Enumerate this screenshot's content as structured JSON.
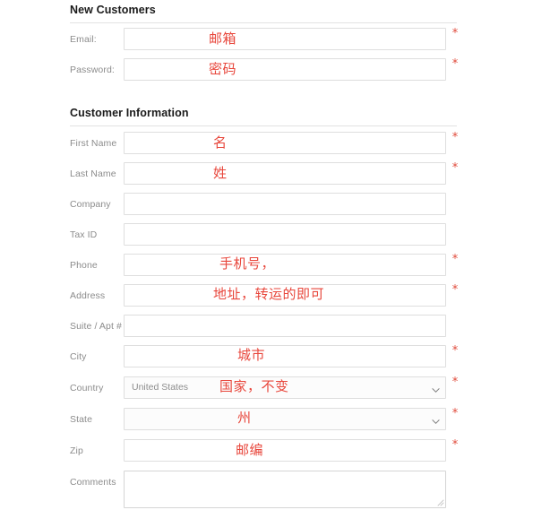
{
  "sections": [
    {
      "title": "New Customers"
    },
    {
      "title": "Customer Information"
    }
  ],
  "fields": {
    "email": {
      "label": "Email:",
      "value": "",
      "placeholder": "",
      "required": true,
      "annotation": "邮箱"
    },
    "password": {
      "label": "Password:",
      "value": "",
      "placeholder": "",
      "required": true,
      "annotation": "密码"
    },
    "first_name": {
      "label": "First Name",
      "value": "",
      "placeholder": "",
      "required": true,
      "annotation": "名"
    },
    "last_name": {
      "label": "Last Name",
      "value": "",
      "placeholder": "",
      "required": true,
      "annotation": "姓"
    },
    "company": {
      "label": "Company",
      "value": "",
      "placeholder": "",
      "required": false,
      "annotation": ""
    },
    "tax_id": {
      "label": "Tax ID",
      "value": "",
      "placeholder": "",
      "required": false,
      "annotation": ""
    },
    "phone": {
      "label": "Phone",
      "value": "",
      "placeholder": "",
      "required": true,
      "annotation": "手机号，"
    },
    "address": {
      "label": "Address",
      "value": "",
      "placeholder": "",
      "required": true,
      "annotation": "地址，转运的即可"
    },
    "suite": {
      "label": "Suite / Apt #",
      "value": "",
      "placeholder": "",
      "required": false,
      "annotation": ""
    },
    "city": {
      "label": "City",
      "value": "",
      "placeholder": "",
      "required": true,
      "annotation": "城市"
    },
    "country": {
      "label": "Country",
      "value": "United States",
      "placeholder": "United States",
      "required": true,
      "annotation": "国家，不变",
      "selected_option": "United States"
    },
    "state": {
      "label": "State",
      "value": "",
      "placeholder": "",
      "required": true,
      "annotation": "州"
    },
    "zip": {
      "label": "Zip",
      "value": "",
      "placeholder": "",
      "required": true,
      "annotation": "邮编"
    },
    "comments": {
      "label": "Comments",
      "value": "",
      "placeholder": "",
      "required": false,
      "annotation": ""
    }
  },
  "required_marker": "*",
  "icons": {
    "chevron_down": "chevron-down-icon",
    "resize_grip": "resize-handle-icon"
  },
  "colors": {
    "annotation_red": "#e8473c",
    "required_red": "#e04b3b",
    "label_gray": "#8c8c8c",
    "heading_black": "#1a1a1a",
    "border_gray": "#dedede",
    "rule_gray": "#e2e2e2"
  }
}
